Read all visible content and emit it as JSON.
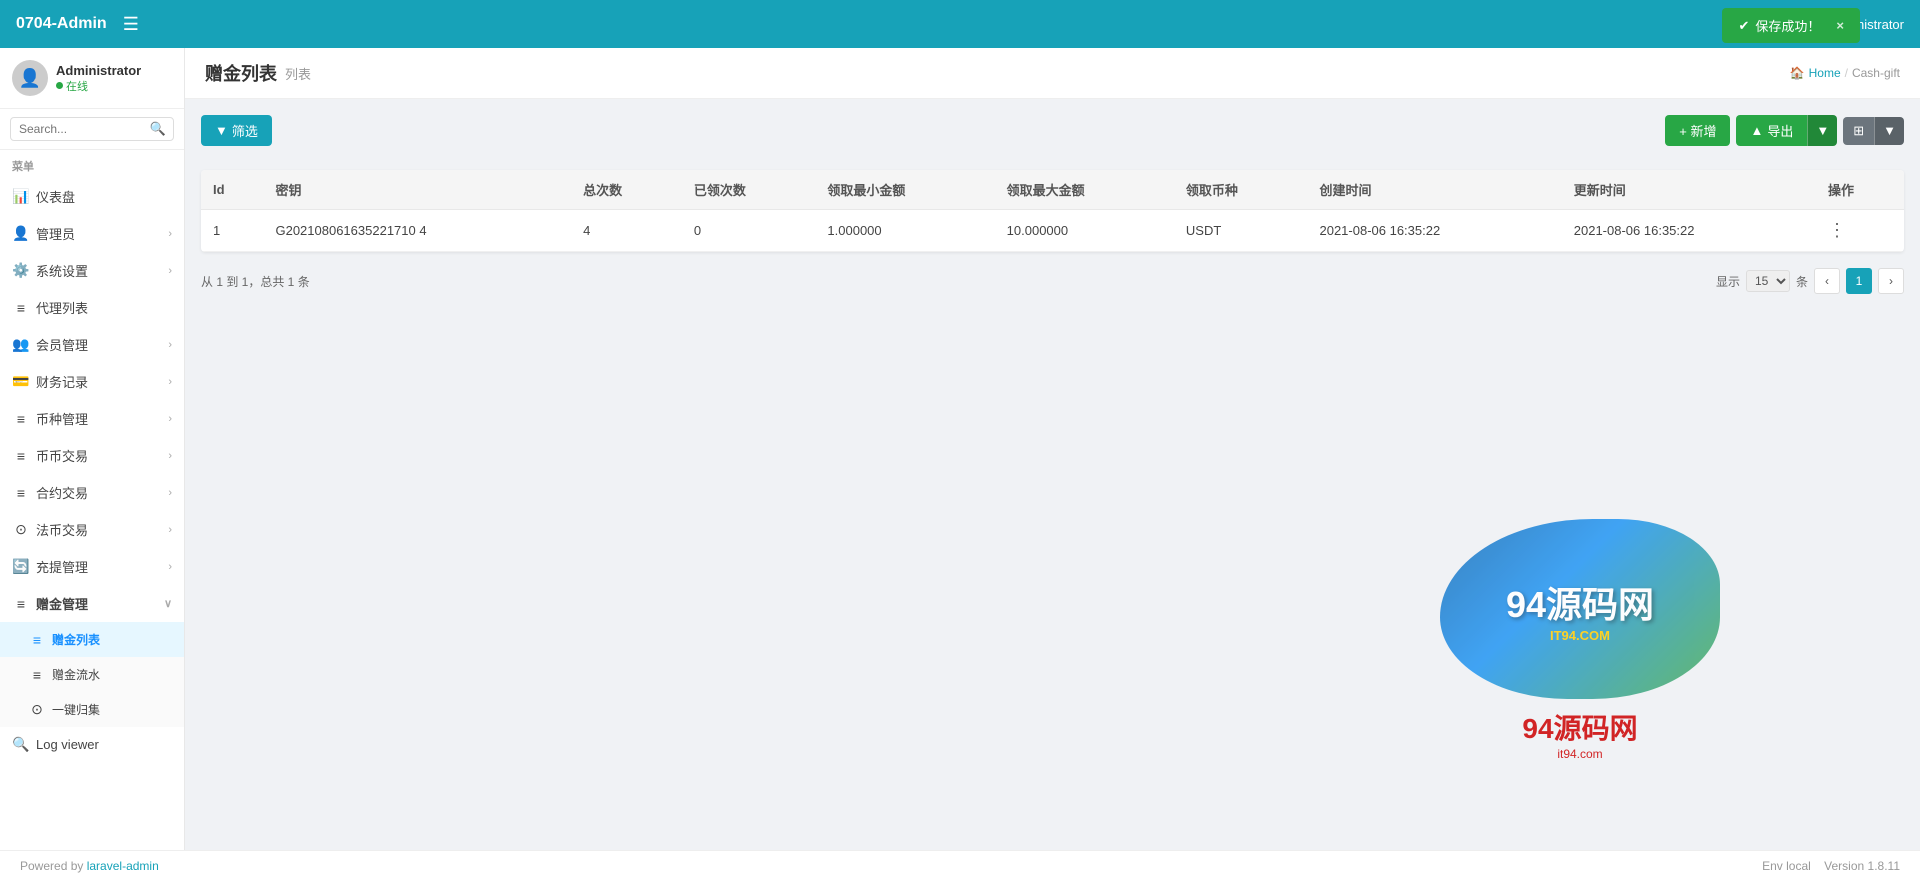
{
  "header": {
    "title": "0704-Admin",
    "hamburger_label": "☰",
    "user_name": "Administrator",
    "home_link": "Home",
    "current_page_link": "Cash-gift"
  },
  "toast": {
    "message": "保存成功！",
    "close": "×"
  },
  "sidebar": {
    "user": {
      "name": "Administrator",
      "status": "在线"
    },
    "search": {
      "placeholder": "Search..."
    },
    "section_label": "菜单",
    "items": [
      {
        "id": "dashboard",
        "icon": "📊",
        "label": "仪表盘",
        "has_children": false
      },
      {
        "id": "admin",
        "icon": "👤",
        "label": "管理员",
        "has_children": true
      },
      {
        "id": "system",
        "icon": "⚙️",
        "label": "系统设置",
        "has_children": true
      },
      {
        "id": "agent",
        "icon": "≡",
        "label": "代理列表",
        "has_children": false
      },
      {
        "id": "member",
        "icon": "👥",
        "label": "会员管理",
        "has_children": true
      },
      {
        "id": "finance",
        "icon": "💳",
        "label": "财务记录",
        "has_children": true
      },
      {
        "id": "currency",
        "icon": "≡",
        "label": "币种管理",
        "has_children": true
      },
      {
        "id": "trade",
        "icon": "≡",
        "label": "币币交易",
        "has_children": true
      },
      {
        "id": "contract",
        "icon": "≡",
        "label": "合约交易",
        "has_children": true
      },
      {
        "id": "fiat",
        "icon": "⊙",
        "label": "法币交易",
        "has_children": true
      },
      {
        "id": "recharge",
        "icon": "🔄",
        "label": "充提管理",
        "has_children": true
      },
      {
        "id": "gift",
        "icon": "≡",
        "label": "赠金管理",
        "has_children": true,
        "expanded": true
      },
      {
        "id": "gift-list",
        "icon": "≡",
        "label": "赠金列表",
        "sub": true,
        "active": true
      },
      {
        "id": "gift-flow",
        "icon": "≡",
        "label": "赠金流水",
        "sub": true
      },
      {
        "id": "collect",
        "icon": "⊙",
        "label": "一键归集",
        "sub": true
      },
      {
        "id": "logviewer",
        "icon": "🔍",
        "label": "Log viewer",
        "has_children": false
      }
    ]
  },
  "page": {
    "title": "赠金列表",
    "subtitle": "列表",
    "breadcrumb": {
      "home": "Home",
      "current": "Cash-gift"
    }
  },
  "toolbar": {
    "filter_label": "筛选",
    "new_label": "+ 新增",
    "export_label": "▲ 导出",
    "cols_label": "⊞"
  },
  "table": {
    "columns": [
      "Id",
      "密钥",
      "总次数",
      "已领次数",
      "领取最小金额",
      "领取最大金额",
      "领取币种",
      "创建时间",
      "更新时间",
      "操作"
    ],
    "rows": [
      {
        "id": "1",
        "key": "G202108061635221710 4",
        "total": "4",
        "claimed": "0",
        "min_amount": "1.000000",
        "max_amount": "10.000000",
        "currency": "USDT",
        "created_at": "2021-08-06 16:35:22",
        "updated_at": "2021-08-06 16:35:22",
        "action": "⋮"
      }
    ]
  },
  "pagination": {
    "info": "从 1 到 1，总共 1 条",
    "display_label": "显示",
    "per_page": "15",
    "total_label": "条",
    "prev": "‹",
    "current_page": "1",
    "next": "›"
  },
  "footer": {
    "powered_by": "Powered by",
    "link_text": "laravel-admin",
    "env": "Env  local",
    "version": "Version  1.8.11"
  },
  "colors": {
    "primary": "#17a2b8",
    "success": "#28a745",
    "sidebar_bg": "#ffffff",
    "header_bg": "#17a2b8",
    "active_item": "#e6f7ff"
  }
}
